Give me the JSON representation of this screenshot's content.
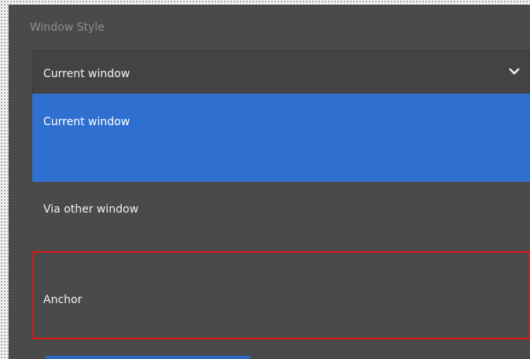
{
  "window_style": {
    "label": "Window Style",
    "selected_value": "Current window",
    "options": [
      {
        "label": "Current window",
        "selected": true
      },
      {
        "label": "Via other window",
        "selected": false
      },
      {
        "label": "Anchor",
        "selected": false,
        "highlighted_outline": true
      }
    ]
  },
  "icons": {
    "dropdown_toggle": "chevron-down-icon"
  },
  "colors": {
    "panel": "#4a4a4a",
    "selected_option": "#2f6fd0",
    "highlight_outline": "#e01717",
    "text": "#f1f1f1",
    "label": "#8d8d8d"
  }
}
